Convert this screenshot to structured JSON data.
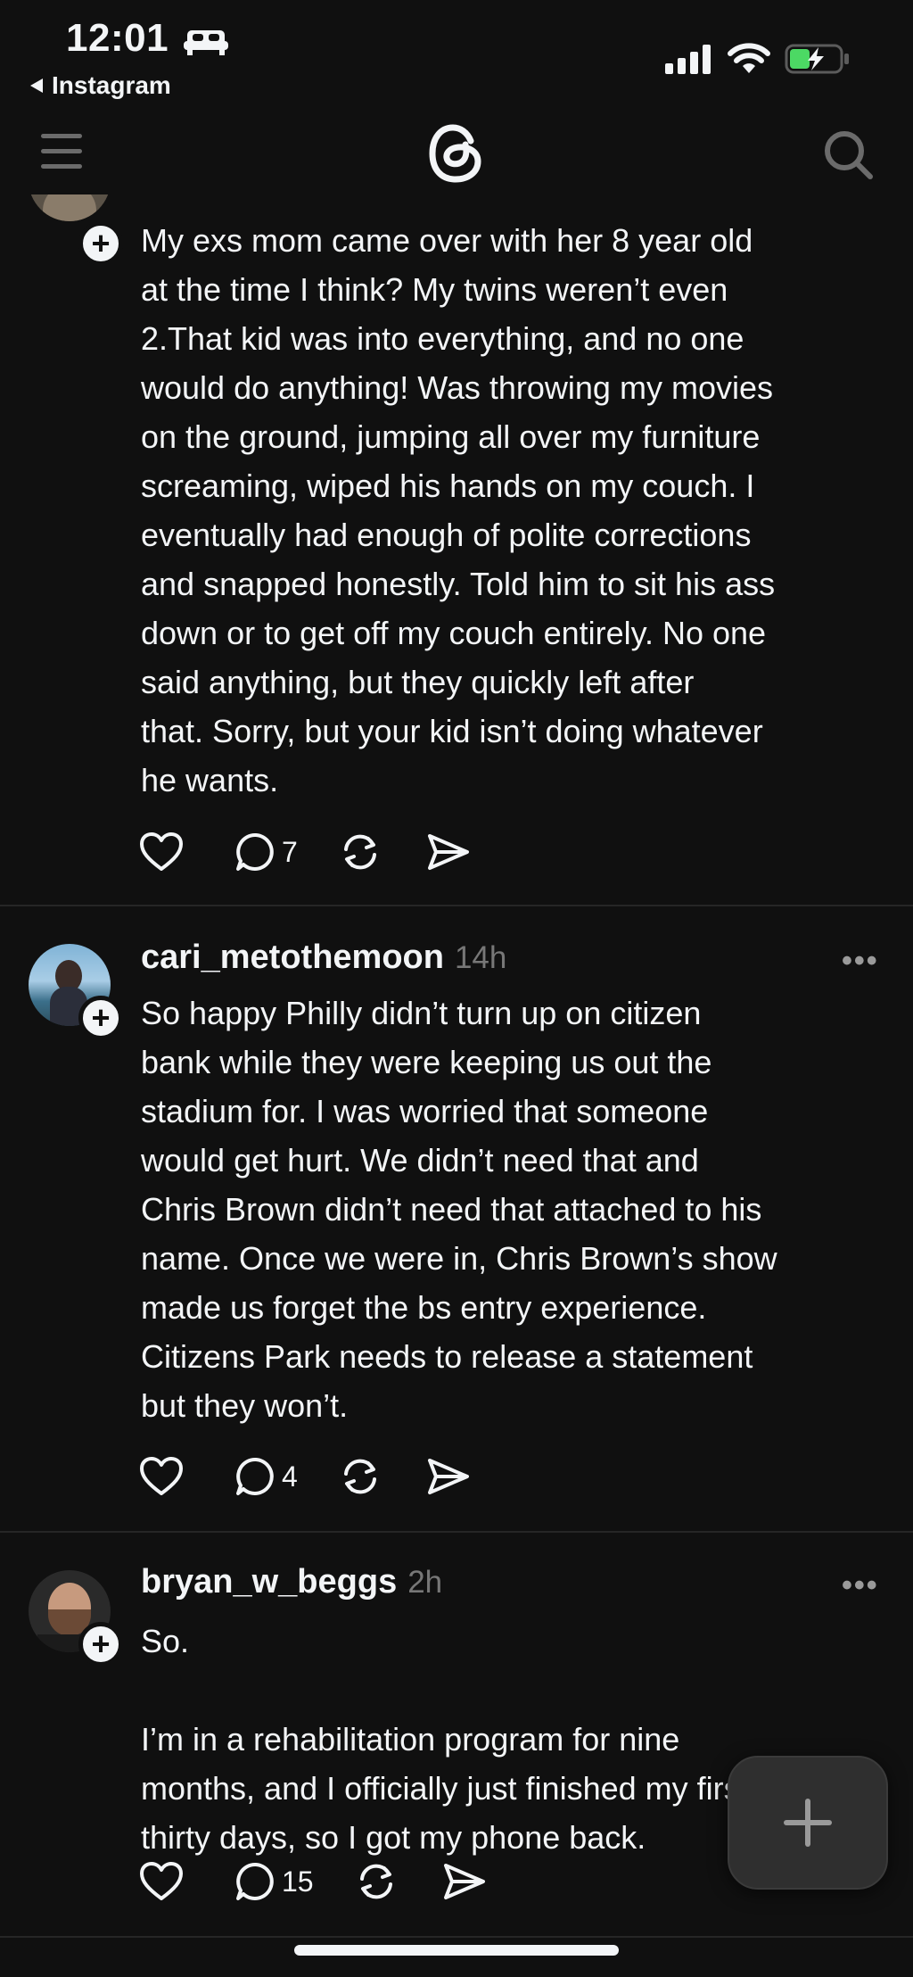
{
  "status_bar": {
    "time": "12:01",
    "back_app": "Instagram"
  },
  "posts": [
    {
      "username": "",
      "time": "",
      "text": "My exs mom came over with her 8 year old\nat the time I think? My twins weren’t even\n2.That kid was into everything, and no one\nwould do anything! Was throwing my movies\non the ground, jumping all over my furniture\nscreaming, wiped his hands on my couch. I\neventually had enough of polite corrections\nand snapped honestly. Told him to sit his ass\ndown or to get off my couch entirely. No one\nsaid anything, but they quickly left after\nthat. Sorry, but your kid isn’t doing whatever\nhe wants.",
      "replies": "7"
    },
    {
      "username": "cari_metothemoon",
      "time": "14h",
      "text": "So happy Philly didn’t turn up on citizen\nbank while they were keeping us out the\nstadium for. I was worried that someone\nwould get hurt. We didn’t need that and\nChris Brown didn’t need that attached to his\nname. Once we were in, Chris Brown’s show\nmade us forget the bs entry experience.\nCitizens Park needs to release a statement\nbut they won’t.",
      "replies": "4"
    },
    {
      "username": "bryan_w_beggs",
      "time": "2h",
      "text": "So.\n\nI’m in a rehabilitation program for nine\nmonths, and I officially just finished my first\nthirty days, so I got my phone back.",
      "replies": "15"
    }
  ],
  "icons": {
    "like": "heart-icon",
    "reply": "speech-bubble-icon",
    "repost": "repost-icon",
    "share": "send-icon",
    "menu": "menu-icon",
    "logo": "threads-logo",
    "search": "search-icon",
    "compose": "plus-icon"
  },
  "colors": {
    "background": "#101010",
    "text": "#f3f5f7",
    "muted": "#777777",
    "divider": "#262626"
  }
}
